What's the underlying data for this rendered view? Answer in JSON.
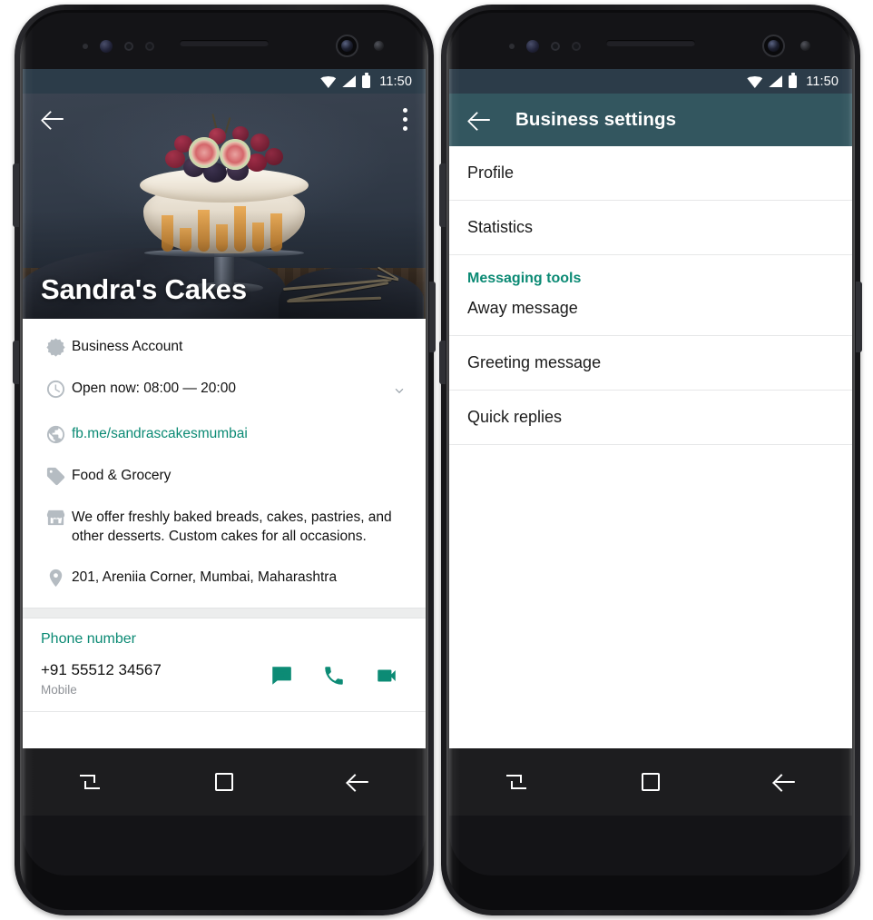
{
  "colors": {
    "status_bar": "#2c3c49",
    "app_bar": "#33565f",
    "accent_teal": "#0b8a74",
    "action_teal": "#0c8b75",
    "icon_grey": "#b5bcc2",
    "nav_bar": "#1d1d1f"
  },
  "status_bar": {
    "time": "11:50",
    "icons": [
      "wifi-icon",
      "signal-icon",
      "battery-icon"
    ]
  },
  "left_phone": {
    "hero": {
      "back_icon": "back-arrow-icon",
      "overflow_icon": "kebab-menu-icon",
      "business_name": "Sandra's Cakes",
      "photo_description": "pavlova cake with berries and figs on a glass cake stand"
    },
    "info_rows": [
      {
        "icon": "verified-badge-icon",
        "text": "Business Account",
        "link": false,
        "chevron": false
      },
      {
        "icon": "clock-icon",
        "text": "Open now: 08:00 — 20:00",
        "link": false,
        "chevron": true
      },
      {
        "icon": "globe-icon",
        "text": "fb.me/sandrascakesmumbai",
        "link": true,
        "chevron": false
      },
      {
        "icon": "tag-icon",
        "text": "Food & Grocery",
        "link": false,
        "chevron": false
      },
      {
        "icon": "storefront-icon",
        "text": "We offer freshly baked breads, cakes, pastries, and other desserts. Custom cakes for all occasions.",
        "link": false,
        "chevron": false
      },
      {
        "icon": "location-pin-icon",
        "text": "201, Areniia Corner, Mumbai, Maharashtra",
        "link": false,
        "chevron": false
      }
    ],
    "phone_section": {
      "label": "Phone number",
      "number": "+91 55512 34567",
      "type": "Mobile",
      "actions": [
        "message-icon",
        "call-icon",
        "video-call-icon"
      ]
    }
  },
  "right_phone": {
    "app_bar": {
      "back_icon": "back-arrow-icon",
      "title": "Business settings"
    },
    "items": [
      {
        "label": "Profile",
        "kind": "item"
      },
      {
        "label": "Statistics",
        "kind": "item"
      },
      {
        "label": "Messaging tools",
        "kind": "group"
      },
      {
        "label": "Away message",
        "kind": "item"
      },
      {
        "label": "Greeting message",
        "kind": "item"
      },
      {
        "label": "Quick replies",
        "kind": "item"
      }
    ]
  },
  "nav_bar": {
    "buttons": [
      "recents-icon",
      "home-icon",
      "back-icon"
    ]
  }
}
